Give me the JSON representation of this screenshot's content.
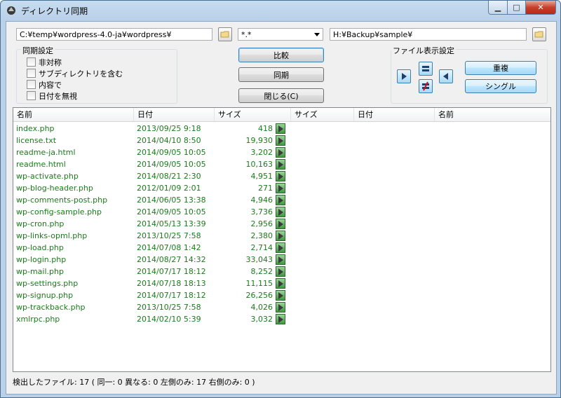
{
  "window": {
    "title": "ディレクトリ同期"
  },
  "toolbar": {
    "left_path": "C:¥temp¥wordpress-4.0-ja¥wordpress¥",
    "filter": "*.*",
    "right_path": "H:¥Backup¥sample¥"
  },
  "sync_settings": {
    "legend": "同期設定",
    "options": [
      {
        "label": "非対称",
        "checked": false
      },
      {
        "label": "サブディレクトリを含む",
        "checked": false
      },
      {
        "label": "内容で",
        "checked": false
      },
      {
        "label": "日付を無視",
        "checked": false
      }
    ]
  },
  "actions": {
    "compare": "比較",
    "sync": "同期",
    "close": "閉じる(C)"
  },
  "display_settings": {
    "legend": "ファイル表示設定",
    "duplicate": "重複",
    "single": "シングル"
  },
  "columns": {
    "left": [
      "名前",
      "日付",
      "サイズ"
    ],
    "right": [
      "サイズ",
      "日付",
      "名前"
    ]
  },
  "files": [
    {
      "name": "index.php",
      "date": "2013/09/25 9:18",
      "size": "418"
    },
    {
      "name": "license.txt",
      "date": "2014/04/10 8:50",
      "size": "19,930"
    },
    {
      "name": "readme-ja.html",
      "date": "2014/09/05 10:05",
      "size": "3,202"
    },
    {
      "name": "readme.html",
      "date": "2014/09/05 10:05",
      "size": "10,163"
    },
    {
      "name": "wp-activate.php",
      "date": "2014/08/21 2:30",
      "size": "4,951"
    },
    {
      "name": "wp-blog-header.php",
      "date": "2012/01/09 2:01",
      "size": "271"
    },
    {
      "name": "wp-comments-post.php",
      "date": "2014/06/05 13:38",
      "size": "4,946"
    },
    {
      "name": "wp-config-sample.php",
      "date": "2014/09/05 10:05",
      "size": "3,736"
    },
    {
      "name": "wp-cron.php",
      "date": "2014/05/13 13:39",
      "size": "2,956"
    },
    {
      "name": "wp-links-opml.php",
      "date": "2013/10/25 7:58",
      "size": "2,380"
    },
    {
      "name": "wp-load.php",
      "date": "2014/07/08 1:42",
      "size": "2,714"
    },
    {
      "name": "wp-login.php",
      "date": "2014/08/27 14:32",
      "size": "33,043"
    },
    {
      "name": "wp-mail.php",
      "date": "2014/07/17 18:12",
      "size": "8,252"
    },
    {
      "name": "wp-settings.php",
      "date": "2014/07/18 18:13",
      "size": "11,115"
    },
    {
      "name": "wp-signup.php",
      "date": "2014/07/17 18:12",
      "size": "26,256"
    },
    {
      "name": "wp-trackback.php",
      "date": "2013/10/25 7:58",
      "size": "4,026"
    },
    {
      "name": "xmlrpc.php",
      "date": "2014/02/10 5:39",
      "size": "3,032"
    }
  ],
  "status": "検出したファイル: 17 ( 同一: 0  異なる: 0  左側のみ: 17 右側のみ: 0 )",
  "colors": {
    "file_text": "#1c7a1c",
    "marker_fill": "#3e9a3e"
  }
}
